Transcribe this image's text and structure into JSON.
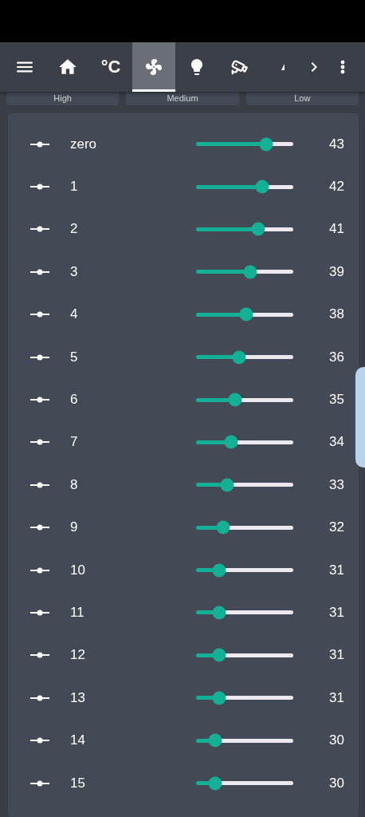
{
  "toolbar": {
    "tabs": [
      {
        "kind": "home",
        "selected": false
      },
      {
        "kind": "text",
        "label": "°C",
        "selected": false
      },
      {
        "kind": "fan",
        "selected": true
      },
      {
        "kind": "bulb",
        "selected": false
      },
      {
        "kind": "camera",
        "selected": false
      },
      {
        "kind": "partial",
        "selected": false
      }
    ]
  },
  "mode_buttons": [
    "High",
    "Medium",
    "Low"
  ],
  "sliders": [
    {
      "name": "zero",
      "value": "43",
      "level": 0.72
    },
    {
      "name": "1",
      "value": "42",
      "level": 0.68
    },
    {
      "name": "2",
      "value": "41",
      "level": 0.64
    },
    {
      "name": "3",
      "value": "39",
      "level": 0.56
    },
    {
      "name": "4",
      "value": "38",
      "level": 0.52
    },
    {
      "name": "5",
      "value": "36",
      "level": 0.44
    },
    {
      "name": "6",
      "value": "35",
      "level": 0.4
    },
    {
      "name": "7",
      "value": "34",
      "level": 0.36
    },
    {
      "name": "8",
      "value": "33",
      "level": 0.32
    },
    {
      "name": "9",
      "value": "32",
      "level": 0.28
    },
    {
      "name": "10",
      "value": "31",
      "level": 0.24
    },
    {
      "name": "11",
      "value": "31",
      "level": 0.24
    },
    {
      "name": "12",
      "value": "31",
      "level": 0.24
    },
    {
      "name": "13",
      "value": "31",
      "level": 0.24
    },
    {
      "name": "14",
      "value": "30",
      "level": 0.2
    },
    {
      "name": "15",
      "value": "30",
      "level": 0.2
    }
  ]
}
